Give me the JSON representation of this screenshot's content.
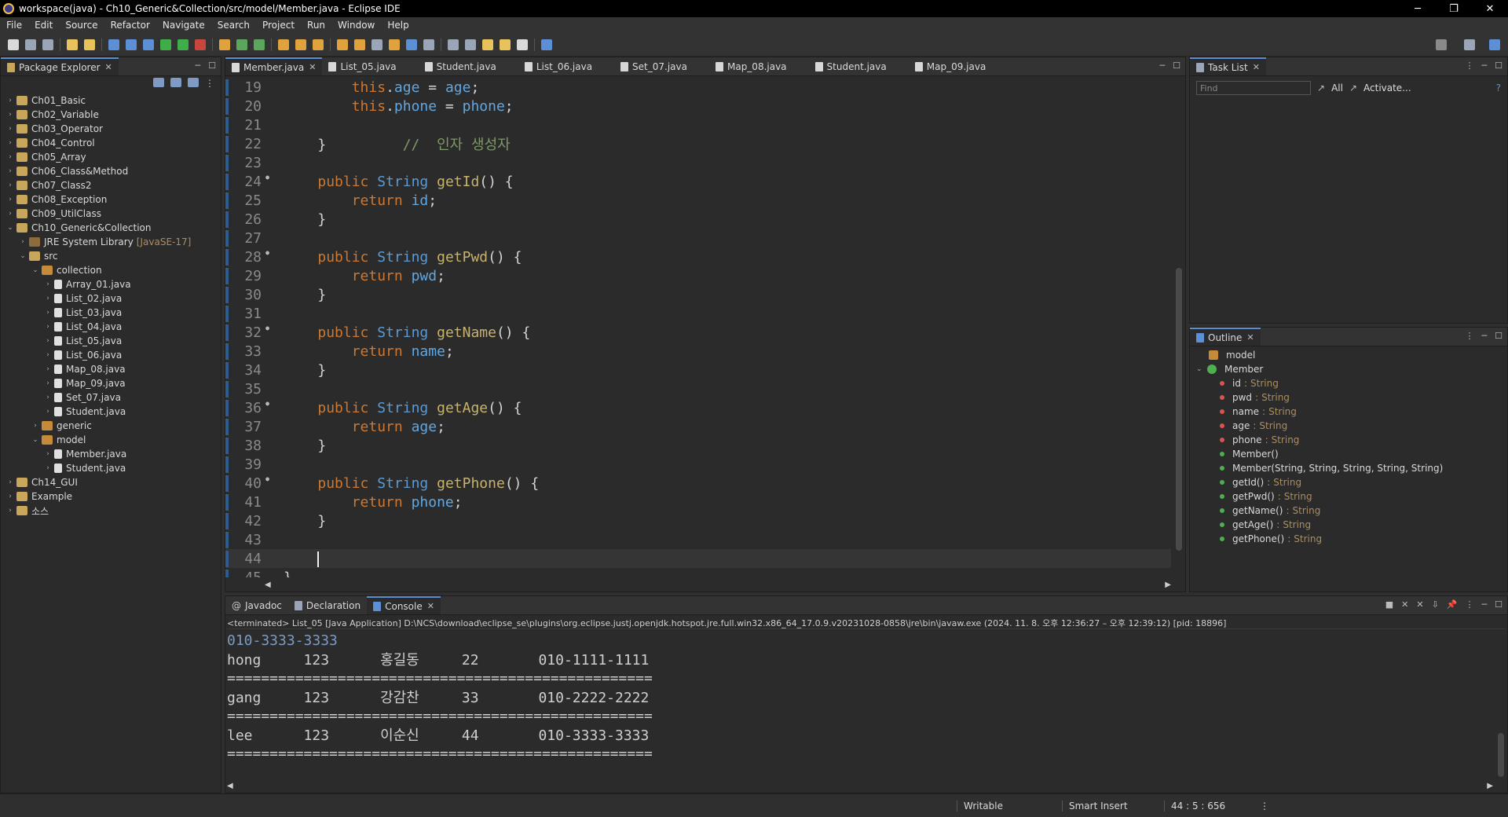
{
  "window": {
    "title": "workspace(java) - Ch10_Generic&Collection/src/model/Member.java - Eclipse IDE",
    "controls": [
      "─",
      "❐",
      "✕"
    ]
  },
  "menu": [
    "File",
    "Edit",
    "Source",
    "Refactor",
    "Navigate",
    "Search",
    "Project",
    "Run",
    "Window",
    "Help"
  ],
  "package_explorer": {
    "title": "Package Explorer",
    "items": [
      {
        "label": "Ch01_Basic",
        "indent": 0,
        "icon": "project-icon",
        "arrow": "›"
      },
      {
        "label": "Ch02_Variable",
        "indent": 0,
        "icon": "project-icon",
        "arrow": "›"
      },
      {
        "label": "Ch03_Operator",
        "indent": 0,
        "icon": "project-icon",
        "arrow": "›"
      },
      {
        "label": "Ch04_Control",
        "indent": 0,
        "icon": "project-icon",
        "arrow": "›"
      },
      {
        "label": "Ch05_Array",
        "indent": 0,
        "icon": "project-icon",
        "arrow": "›"
      },
      {
        "label": "Ch06_Class&Method",
        "indent": 0,
        "icon": "project-icon",
        "arrow": "›"
      },
      {
        "label": "Ch07_Class2",
        "indent": 0,
        "icon": "project-icon",
        "arrow": "›"
      },
      {
        "label": "Ch08_Exception",
        "indent": 0,
        "icon": "project-icon",
        "arrow": "›"
      },
      {
        "label": "Ch09_UtilClass",
        "indent": 0,
        "icon": "project-icon",
        "arrow": "›"
      },
      {
        "label": "Ch10_Generic&Collection",
        "indent": 0,
        "icon": "project-icon",
        "arrow": "⌄"
      },
      {
        "label": "JRE System Library",
        "deco": "[JavaSE-17]",
        "indent": 1,
        "icon": "library-icon",
        "arrow": "›"
      },
      {
        "label": "src",
        "indent": 1,
        "icon": "source-folder-icon",
        "arrow": "⌄"
      },
      {
        "label": "collection",
        "indent": 2,
        "icon": "package-icon",
        "arrow": "⌄"
      },
      {
        "label": "Array_01.java",
        "indent": 3,
        "icon": "java-file-icon",
        "arrow": "›"
      },
      {
        "label": "List_02.java",
        "indent": 3,
        "icon": "java-file-icon",
        "arrow": "›"
      },
      {
        "label": "List_03.java",
        "indent": 3,
        "icon": "java-file-icon",
        "arrow": "›"
      },
      {
        "label": "List_04.java",
        "indent": 3,
        "icon": "java-file-icon",
        "arrow": "›"
      },
      {
        "label": "List_05.java",
        "indent": 3,
        "icon": "java-file-icon",
        "arrow": "›"
      },
      {
        "label": "List_06.java",
        "indent": 3,
        "icon": "java-file-icon",
        "arrow": "›"
      },
      {
        "label": "Map_08.java",
        "indent": 3,
        "icon": "java-file-icon",
        "arrow": "›"
      },
      {
        "label": "Map_09.java",
        "indent": 3,
        "icon": "java-file-icon",
        "arrow": "›"
      },
      {
        "label": "Set_07.java",
        "indent": 3,
        "icon": "java-file-icon",
        "arrow": "›"
      },
      {
        "label": "Student.java",
        "indent": 3,
        "icon": "java-file-icon",
        "arrow": "›"
      },
      {
        "label": "generic",
        "indent": 2,
        "icon": "package-icon",
        "arrow": "›"
      },
      {
        "label": "model",
        "indent": 2,
        "icon": "package-icon",
        "arrow": "⌄"
      },
      {
        "label": "Member.java",
        "indent": 3,
        "icon": "java-file-icon",
        "arrow": "›"
      },
      {
        "label": "Student.java",
        "indent": 3,
        "icon": "java-file-icon",
        "arrow": "›"
      },
      {
        "label": "Ch14_GUI",
        "indent": 0,
        "icon": "project-icon",
        "arrow": "›"
      },
      {
        "label": "Example",
        "indent": 0,
        "icon": "project-icon",
        "arrow": "›"
      },
      {
        "label": "소스",
        "indent": 0,
        "icon": "project-icon",
        "arrow": "›"
      }
    ]
  },
  "editor": {
    "tabs": [
      {
        "label": "Member.java",
        "active": true,
        "closable": true
      },
      {
        "label": "List_05.java"
      },
      {
        "label": "Student.java"
      },
      {
        "label": "List_06.java"
      },
      {
        "label": "Set_07.java"
      },
      {
        "label": "Map_08.java"
      },
      {
        "label": "Student.java"
      },
      {
        "label": "Map_09.java"
      }
    ],
    "lines": [
      {
        "n": "19",
        "tokens": [
          [
            "pl",
            "        "
          ],
          [
            "kw",
            "this"
          ],
          [
            "pl",
            "."
          ],
          [
            "fld",
            "age"
          ],
          [
            "pl",
            " = "
          ],
          [
            "fld",
            "age"
          ],
          [
            "pl",
            ";"
          ]
        ]
      },
      {
        "n": "20",
        "tokens": [
          [
            "pl",
            "        "
          ],
          [
            "kw",
            "this"
          ],
          [
            "pl",
            "."
          ],
          [
            "fld",
            "phone"
          ],
          [
            "pl",
            " = "
          ],
          [
            "fld",
            "phone"
          ],
          [
            "pl",
            ";"
          ]
        ]
      },
      {
        "n": "21",
        "tokens": []
      },
      {
        "n": "22",
        "tokens": [
          [
            "pl",
            "    }         "
          ],
          [
            "cm",
            "//  인자 생성자"
          ]
        ]
      },
      {
        "n": "23",
        "tokens": []
      },
      {
        "n": "24",
        "mark": true,
        "tokens": [
          [
            "pl",
            "    "
          ],
          [
            "kw",
            "public"
          ],
          [
            "pl",
            " "
          ],
          [
            "ty",
            "String"
          ],
          [
            "pl",
            " "
          ],
          [
            "fn",
            "getId"
          ],
          [
            "pl",
            "() {"
          ]
        ]
      },
      {
        "n": "25",
        "tokens": [
          [
            "pl",
            "        "
          ],
          [
            "kw",
            "return"
          ],
          [
            "pl",
            " "
          ],
          [
            "fld",
            "id"
          ],
          [
            "pl",
            ";"
          ]
        ]
      },
      {
        "n": "26",
        "tokens": [
          [
            "pl",
            "    }"
          ]
        ]
      },
      {
        "n": "27",
        "tokens": []
      },
      {
        "n": "28",
        "mark": true,
        "tokens": [
          [
            "pl",
            "    "
          ],
          [
            "kw",
            "public"
          ],
          [
            "pl",
            " "
          ],
          [
            "ty",
            "String"
          ],
          [
            "pl",
            " "
          ],
          [
            "fn",
            "getPwd"
          ],
          [
            "pl",
            "() {"
          ]
        ]
      },
      {
        "n": "29",
        "tokens": [
          [
            "pl",
            "        "
          ],
          [
            "kw",
            "return"
          ],
          [
            "pl",
            " "
          ],
          [
            "fld",
            "pwd"
          ],
          [
            "pl",
            ";"
          ]
        ]
      },
      {
        "n": "30",
        "tokens": [
          [
            "pl",
            "    }"
          ]
        ]
      },
      {
        "n": "31",
        "tokens": []
      },
      {
        "n": "32",
        "mark": true,
        "tokens": [
          [
            "pl",
            "    "
          ],
          [
            "kw",
            "public"
          ],
          [
            "pl",
            " "
          ],
          [
            "ty",
            "String"
          ],
          [
            "pl",
            " "
          ],
          [
            "fn",
            "getName"
          ],
          [
            "pl",
            "() {"
          ]
        ]
      },
      {
        "n": "33",
        "tokens": [
          [
            "pl",
            "        "
          ],
          [
            "kw",
            "return"
          ],
          [
            "pl",
            " "
          ],
          [
            "fld",
            "name"
          ],
          [
            "pl",
            ";"
          ]
        ]
      },
      {
        "n": "34",
        "tokens": [
          [
            "pl",
            "    }"
          ]
        ]
      },
      {
        "n": "35",
        "tokens": []
      },
      {
        "n": "36",
        "mark": true,
        "tokens": [
          [
            "pl",
            "    "
          ],
          [
            "kw",
            "public"
          ],
          [
            "pl",
            " "
          ],
          [
            "ty",
            "String"
          ],
          [
            "pl",
            " "
          ],
          [
            "fn",
            "getAge"
          ],
          [
            "pl",
            "() {"
          ]
        ]
      },
      {
        "n": "37",
        "tokens": [
          [
            "pl",
            "        "
          ],
          [
            "kw",
            "return"
          ],
          [
            "pl",
            " "
          ],
          [
            "fld",
            "age"
          ],
          [
            "pl",
            ";"
          ]
        ]
      },
      {
        "n": "38",
        "tokens": [
          [
            "pl",
            "    }"
          ]
        ]
      },
      {
        "n": "39",
        "tokens": []
      },
      {
        "n": "40",
        "mark": true,
        "tokens": [
          [
            "pl",
            "    "
          ],
          [
            "kw",
            "public"
          ],
          [
            "pl",
            " "
          ],
          [
            "ty",
            "String"
          ],
          [
            "pl",
            " "
          ],
          [
            "fn",
            "getPhone"
          ],
          [
            "pl",
            "() {"
          ]
        ]
      },
      {
        "n": "41",
        "tokens": [
          [
            "pl",
            "        "
          ],
          [
            "kw",
            "return"
          ],
          [
            "pl",
            " "
          ],
          [
            "fld",
            "phone"
          ],
          [
            "pl",
            ";"
          ]
        ]
      },
      {
        "n": "42",
        "tokens": [
          [
            "pl",
            "    }"
          ]
        ]
      },
      {
        "n": "43",
        "tokens": []
      },
      {
        "n": "44",
        "current": true,
        "tokens": []
      },
      {
        "n": "45",
        "tokens": [
          [
            "pl",
            "}"
          ]
        ]
      }
    ]
  },
  "task_list": {
    "title": "Task List",
    "find_placeholder": "Find",
    "all_label": "All",
    "activate_label": "Activate..."
  },
  "outline": {
    "title": "Outline",
    "package": "model",
    "class": "Member",
    "members": [
      {
        "name": "id",
        "type": "String",
        "vis": "red"
      },
      {
        "name": "pwd",
        "type": "String",
        "vis": "red"
      },
      {
        "name": "name",
        "type": "String",
        "vis": "red"
      },
      {
        "name": "age",
        "type": "String",
        "vis": "red"
      },
      {
        "name": "phone",
        "type": "String",
        "vis": "red"
      },
      {
        "name": "Member()",
        "type": "",
        "vis": "green"
      },
      {
        "name": "Member(String, String, String, String, String)",
        "type": "",
        "vis": "green"
      },
      {
        "name": "getId()",
        "type": "String",
        "vis": "green"
      },
      {
        "name": "getPwd()",
        "type": "String",
        "vis": "green"
      },
      {
        "name": "getName()",
        "type": "String",
        "vis": "green"
      },
      {
        "name": "getAge()",
        "type": "String",
        "vis": "green"
      },
      {
        "name": "getPhone()",
        "type": "String",
        "vis": "green"
      }
    ]
  },
  "console": {
    "tabs": [
      "Javadoc",
      "Declaration",
      "Console"
    ],
    "terminated": "<terminated> List_05 [Java Application] D:\\NCS\\download\\eclipse_se\\plugins\\org.eclipse.justj.openjdk.hotspot.jre.full.win32.x86_64_17.0.9.v20231028-0858\\jre\\bin\\javaw.exe  (2024. 11. 8. 오후 12:36:27 – 오후 12:39:12) [pid: 18896]",
    "lines": [
      {
        "text": "010-3333-3333",
        "faded": true
      },
      {
        "text": "hong     123      홍길동     22       010-1111-1111"
      },
      {
        "text": "=================================================="
      },
      {
        "text": "gang     123      강감찬     33       010-2222-2222"
      },
      {
        "text": "=================================================="
      },
      {
        "text": "lee      123      이순신     44       010-3333-3333"
      },
      {
        "text": "=================================================="
      }
    ]
  },
  "status": {
    "writable": "Writable",
    "insert_mode": "Smart Insert",
    "position": "44 : 5 : 656"
  }
}
